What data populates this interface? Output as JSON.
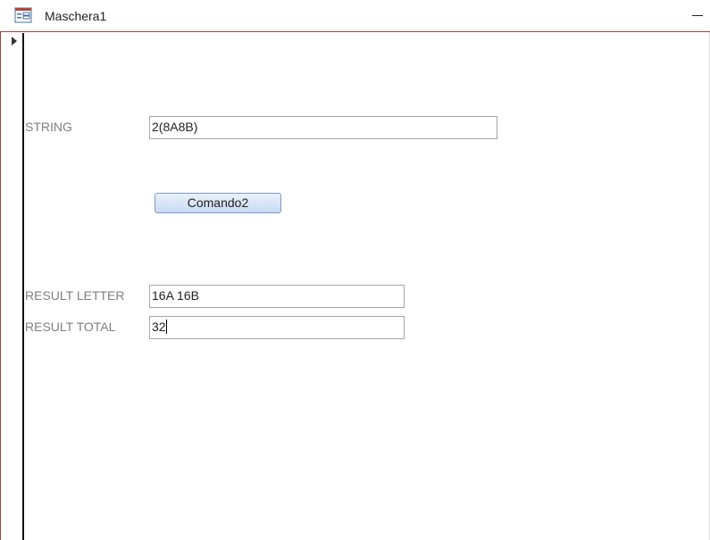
{
  "window": {
    "title": "Maschera1"
  },
  "form": {
    "string_label": "STRING",
    "string_value": "2(8A8B)",
    "command_button_label": "Comando2",
    "result_letter_label": "RESULT LETTER",
    "result_letter_value": "16A 16B",
    "result_total_label": "RESULT TOTAL",
    "result_total_value": "32"
  },
  "colors": {
    "accent": "#a0413a",
    "label_text": "#7f7f7f",
    "button_fill": "#c9daf3"
  },
  "icons": {
    "window_icon": "form-icon",
    "minimize": "minimize-icon",
    "record_pointer": "record-selector-arrow-icon"
  }
}
